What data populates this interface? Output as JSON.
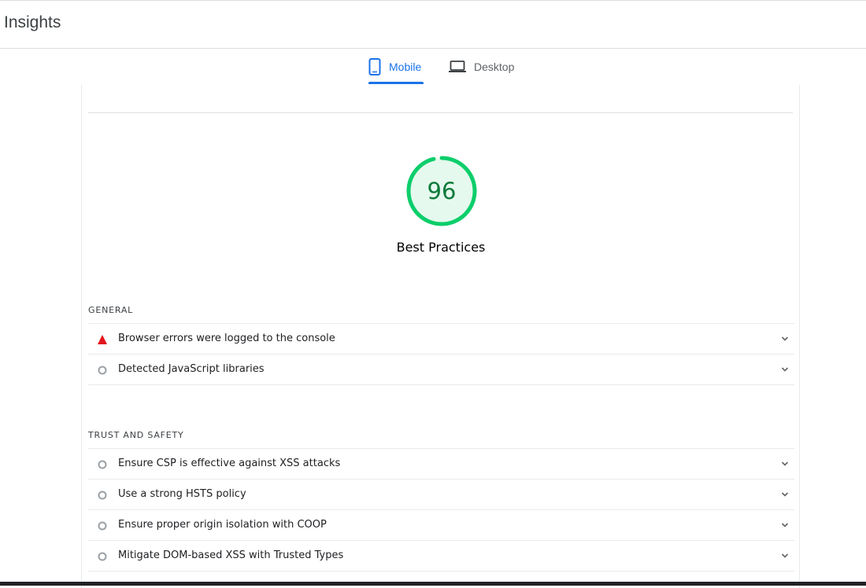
{
  "header": {
    "title": "Insights"
  },
  "tabs": [
    {
      "label": "Mobile",
      "icon": "phone-icon",
      "selected": true
    },
    {
      "label": "Desktop",
      "icon": "laptop-icon",
      "selected": false
    }
  ],
  "colors": {
    "accent": "#1a73e8",
    "pass": "#0cce6b",
    "pass_text": "#0c7a3a",
    "fail": "#e3141c",
    "neutral": "#9aa0a6"
  },
  "gauge": {
    "score": "96",
    "score_fraction": 0.96,
    "label": "Best Practices"
  },
  "groups": [
    {
      "title": "GENERAL",
      "audits": [
        {
          "label": "Browser errors were logged to the console",
          "status": "fail",
          "icon": "warning-triangle-icon"
        },
        {
          "label": "Detected JavaScript libraries",
          "status": "informative",
          "icon": "circle-icon"
        }
      ]
    },
    {
      "title": "TRUST AND SAFETY",
      "audits": [
        {
          "label": "Ensure CSP is effective against XSS attacks",
          "status": "informative",
          "icon": "circle-icon"
        },
        {
          "label": "Use a strong HSTS policy",
          "status": "informative",
          "icon": "circle-icon"
        },
        {
          "label": "Ensure proper origin isolation with COOP",
          "status": "informative",
          "icon": "circle-icon"
        },
        {
          "label": "Mitigate DOM-based XSS with Trusted Types",
          "status": "informative",
          "icon": "circle-icon"
        }
      ]
    }
  ]
}
